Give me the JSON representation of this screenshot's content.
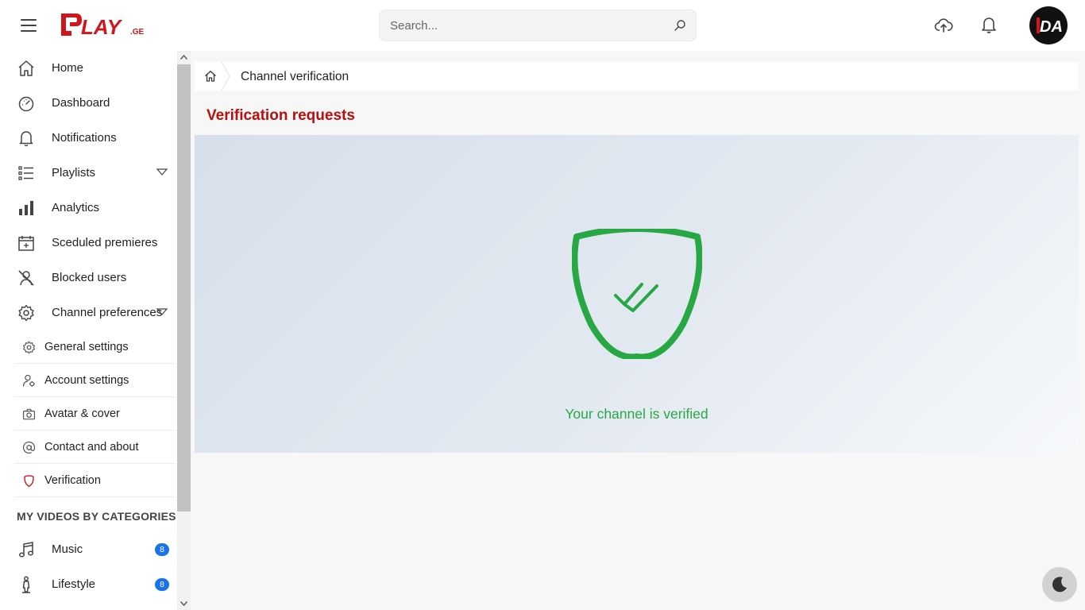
{
  "header": {
    "search_placeholder": "Search...",
    "logo_text": "PLAY.GE",
    "avatar_text": "DA"
  },
  "sidebar": {
    "items": [
      {
        "label": "Home",
        "icon": "home-icon"
      },
      {
        "label": "Dashboard",
        "icon": "gauge-icon"
      },
      {
        "label": "Notifications",
        "icon": "bell-icon"
      },
      {
        "label": "Playlists",
        "icon": "list-icon"
      },
      {
        "label": "Analytics",
        "icon": "bar-chart-icon"
      },
      {
        "label": "Sceduled premieres",
        "icon": "calendar-icon"
      },
      {
        "label": "Blocked users",
        "icon": "user-blocked-icon"
      },
      {
        "label": "Channel preferences",
        "icon": "gear-icon"
      }
    ],
    "sub_items": [
      {
        "label": "General settings",
        "icon": "gear-icon"
      },
      {
        "label": "Account settings",
        "icon": "user-gear-icon"
      },
      {
        "label": "Avatar & cover",
        "icon": "camera-icon"
      },
      {
        "label": "Contact and about",
        "icon": "at-icon"
      },
      {
        "label": "Verification",
        "icon": "shield-icon"
      }
    ],
    "section_title": "MY VIDEOS BY CATEGORIES",
    "categories": [
      {
        "label": "Music",
        "count": "8",
        "icon": "music-icon"
      },
      {
        "label": "Lifestyle",
        "count": "8",
        "icon": "person-icon"
      }
    ]
  },
  "breadcrumb": {
    "current": "Channel verification"
  },
  "main": {
    "title": "Verification requests",
    "status_text": "Your channel is verified"
  },
  "colors": {
    "brand_red": "#d3141b",
    "title_red": "#b80f0f",
    "verified_green": "#28a745",
    "badge_blue": "#1a73e8"
  }
}
